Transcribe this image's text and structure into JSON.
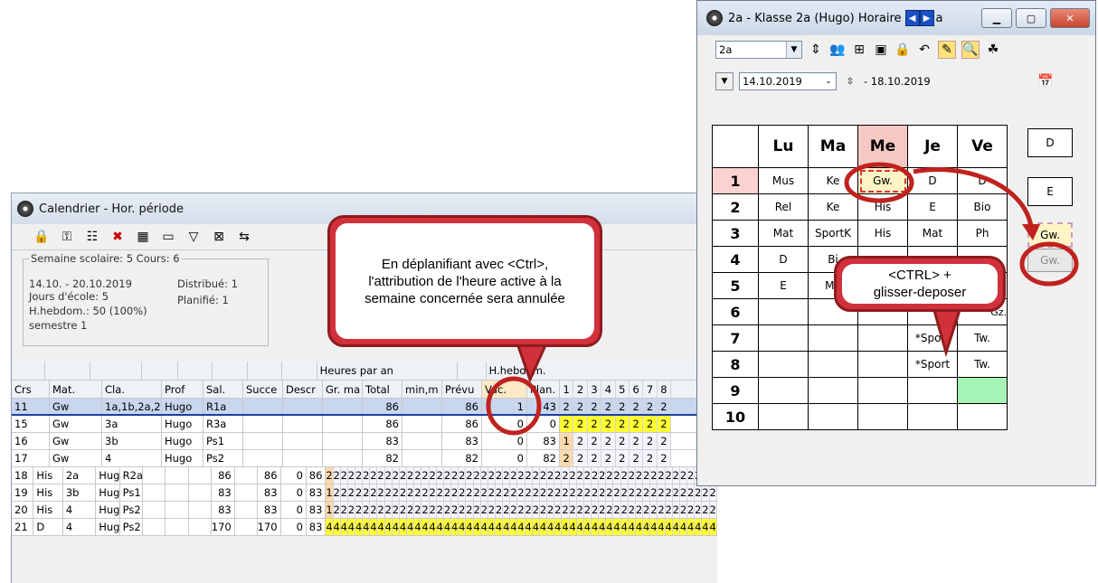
{
  "calendar": {
    "title": "Calendrier - Hor. période",
    "info": {
      "legend": "Semaine scolaire: 5  Cours: 6",
      "dates": "14.10. - 20.10.2019",
      "days": "Jours d'école: 5",
      "weekly": "H.hebdom.: 50 (100%)",
      "semester": "semestre 1",
      "distributed": "Distribué: 1",
      "planned": "Planifié: 1"
    },
    "group_headers": {
      "hours_per_year": "Heures par an",
      "weekly": "H.hebdom."
    },
    "columns": [
      "Crs",
      "Mat.",
      "Cla.",
      "Prof",
      "Sal.",
      "Succe",
      "Descr",
      "Gr. ma",
      "Total",
      "min,m",
      "Prévu",
      "Vac.",
      "Plan."
    ],
    "week_numbers": [
      "1",
      "2",
      "3",
      "4",
      "5",
      "6",
      "7",
      "8"
    ],
    "rows": [
      {
        "crs": "11",
        "mat": "Gw",
        "cla": "1a,1b,2a,2",
        "prof": "Hugo",
        "sal": "R1a",
        "total": "86",
        "prevu": "86",
        "vac": "1",
        "plan": "43",
        "weeks": [
          "2",
          "2",
          "2",
          "2",
          "2",
          "2",
          "2",
          "2"
        ],
        "style": "sel"
      },
      {
        "crs": "15",
        "mat": "Gw",
        "cla": "3a",
        "prof": "Hugo",
        "sal": "R3a",
        "total": "86",
        "prevu": "86",
        "vac": "0",
        "plan": "0",
        "weeks": [
          "2",
          "2",
          "2",
          "2",
          "2",
          "2",
          "2",
          "2"
        ],
        "style": "yellow"
      },
      {
        "crs": "16",
        "mat": "Gw",
        "cla": "3b",
        "prof": "Hugo",
        "sal": "Ps1",
        "total": "83",
        "prevu": "83",
        "vac": "0",
        "plan": "83",
        "weeks": [
          "1",
          "2",
          "2",
          "2",
          "2",
          "2",
          "2",
          "2"
        ],
        "style": "plain"
      },
      {
        "crs": "17",
        "mat": "Gw",
        "cla": "4",
        "prof": "Hugo",
        "sal": "Ps2",
        "total": "82",
        "prevu": "82",
        "vac": "0",
        "plan": "82",
        "weeks": [
          "2",
          "2",
          "2",
          "2",
          "2",
          "2",
          "2",
          "2"
        ],
        "style": "plain"
      },
      {
        "crs": "18",
        "mat": "His",
        "cla": "2a",
        "prof": "Hugo",
        "sal": "R2a",
        "total": "86",
        "prevu": "86",
        "vac": "0",
        "plan": "86",
        "weeks": [
          "2",
          "2",
          "2",
          "2",
          "2",
          "2",
          "2",
          "2",
          "2",
          "2",
          "2",
          "2",
          "2",
          "2",
          "2",
          "2",
          "2",
          "2",
          "2",
          "2",
          "2",
          "2",
          "2",
          "2",
          "2",
          "2",
          "2",
          "2",
          "2",
          "2",
          "2",
          "2",
          "2",
          "2",
          "2",
          "2",
          "2",
          "2",
          "2",
          "2",
          "2",
          "2",
          "2",
          "2",
          "2",
          "2",
          "2",
          "2",
          "2",
          "2",
          "2",
          "2",
          "2"
        ],
        "style": "plain"
      },
      {
        "crs": "19",
        "mat": "His",
        "cla": "3b",
        "prof": "Hugo",
        "sal": "Ps1",
        "total": "83",
        "prevu": "83",
        "vac": "0",
        "plan": "83",
        "weeks": [
          "1",
          "2",
          "2",
          "2",
          "2",
          "2",
          "2",
          "2",
          "2",
          "2",
          "2",
          "2",
          "2",
          "2",
          "2",
          "2",
          "2",
          "2",
          "2",
          "2",
          "2",
          "2",
          "2",
          "2",
          "2",
          "2",
          "2",
          "2",
          "2",
          "2",
          "2",
          "2",
          "2",
          "2",
          "2",
          "2",
          "2",
          "2",
          "2",
          "2",
          "2",
          "2",
          "2",
          "2",
          "2",
          "2",
          "2",
          "2",
          "2",
          "2",
          "2",
          "2",
          "2"
        ],
        "style": "plain"
      },
      {
        "crs": "20",
        "mat": "His",
        "cla": "4",
        "prof": "Hugo",
        "sal": "Ps2",
        "total": "83",
        "prevu": "83",
        "vac": "0",
        "plan": "83",
        "weeks": [
          "1",
          "2",
          "2",
          "2",
          "2",
          "2",
          "2",
          "2",
          "2",
          "2",
          "2",
          "2",
          "2",
          "2",
          "2",
          "2",
          "2",
          "2",
          "2",
          "2",
          "2",
          "2",
          "2",
          "2",
          "2",
          "2",
          "2",
          "2",
          "2",
          "2",
          "2",
          "2",
          "2",
          "2",
          "2",
          "2",
          "2",
          "2",
          "2",
          "2",
          "2",
          "2",
          "2",
          "2",
          "2",
          "2",
          "2",
          "2",
          "2",
          "2",
          "2",
          "2",
          "2"
        ],
        "style": "plain"
      },
      {
        "crs": "21",
        "mat": "D",
        "cla": "4",
        "prof": "Hugo",
        "sal": "Ps2",
        "total": "170",
        "prevu": "170",
        "vac": "0",
        "plan": "83",
        "weeks": [
          "4",
          "4",
          "4",
          "4",
          "4",
          "4",
          "4",
          "4",
          "4",
          "4",
          "4",
          "4",
          "4",
          "4",
          "4",
          "4",
          "4",
          "4",
          "4",
          "4",
          "4",
          "4",
          "4",
          "4",
          "4",
          "4",
          "4",
          "4",
          "4",
          "4",
          "4",
          "4",
          "4",
          "4",
          "4",
          "4",
          "4",
          "4",
          "4",
          "4",
          "4",
          "4",
          "4",
          "4",
          "4",
          "4",
          "4",
          "4",
          "4",
          "4",
          "4",
          "4",
          "4"
        ],
        "style": "yellow"
      }
    ]
  },
  "timetable": {
    "title": "2a - Klasse 2a (Hugo)  Horaire",
    "title_tail": "a",
    "class_select": "2a",
    "date_from": "14.10.2019",
    "date_to": "- 18.10.2019",
    "days": [
      "Lu",
      "Ma",
      "Me",
      "Je",
      "Ve"
    ],
    "periods": [
      "1",
      "2",
      "3",
      "4",
      "5",
      "6",
      "7",
      "8",
      "9",
      "10"
    ],
    "cells": [
      [
        "Mus",
        "Ke",
        "Gw.",
        "D",
        "D"
      ],
      [
        "Rel",
        "Ke",
        "His",
        "E",
        "Bio"
      ],
      [
        "Mat",
        "SportK",
        "His",
        "Mat",
        "Ph"
      ],
      [
        "D",
        "Bi",
        "",
        "",
        ""
      ],
      [
        "E",
        "Ma",
        "",
        "",
        ""
      ],
      [
        "",
        "",
        "",
        "",
        "Gz."
      ],
      [
        "",
        "",
        "",
        "*Sport",
        "Tw."
      ],
      [
        "",
        "",
        "",
        "*Sport",
        "Tw."
      ],
      [
        "",
        "",
        "",
        "",
        ""
      ],
      [
        "",
        "",
        "",
        "",
        ""
      ]
    ],
    "side_cells": [
      "D",
      "E",
      "Gw.",
      "Gw."
    ]
  },
  "callouts": {
    "left": "En déplanifiant avec <Ctrl>, l'attribution de l'heure active à la semaine concernée sera annulée",
    "right_line1": "<CTRL> +",
    "right_line2": "glisser-deposer"
  },
  "colors": {
    "accent_red": "#d1313b",
    "highlight_yellow": "#ffff33",
    "selected_row": "#c8d6ee",
    "free_slot": "#a6f3b6"
  }
}
